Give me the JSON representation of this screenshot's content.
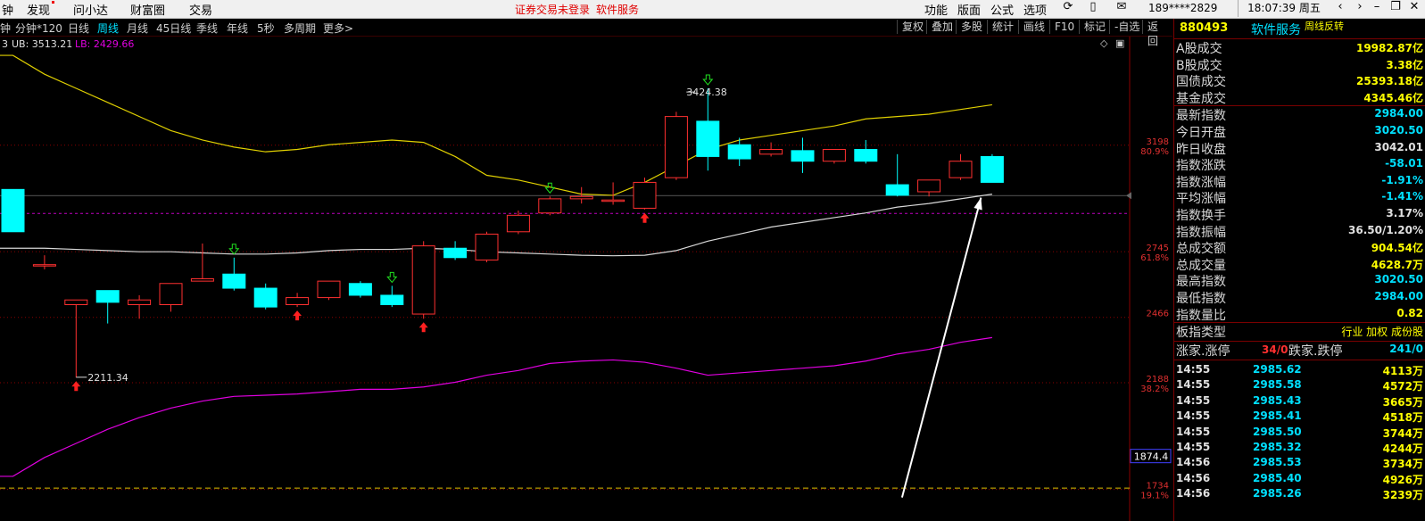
{
  "menu": {
    "items": [
      "钟",
      "发现",
      "问小达",
      "财富圈",
      "交易"
    ],
    "notice1": "证券交易未登录",
    "notice2": "软件服务",
    "right_items": [
      "功能",
      "版面",
      "公式",
      "选项"
    ],
    "phone": "189****2829",
    "clock": "18:07:39 周五"
  },
  "tabs": {
    "items": [
      "分钟*120",
      "日线",
      "周线",
      "月线",
      "45日线",
      "季线",
      "年线",
      "5秒",
      "多周期",
      "更多>"
    ],
    "active": "周线",
    "right_buttons": [
      "复权",
      "叠加",
      "多股",
      "统计",
      "画线",
      "F10",
      "标记",
      "-自选",
      "返回"
    ]
  },
  "indicator": {
    "prefix": "3",
    "ub": "UB: 3513.21",
    "lb": "LB: 2429.66"
  },
  "colors": {
    "up": "#ff3030",
    "down": "#00ffff",
    "upper_band": "#e0d000",
    "mid_band": "#d8d8d8",
    "lower_band": "#e000e0",
    "grid": "#8a0000",
    "level_line": "#e0c000",
    "current_price_line": "#c000c0"
  },
  "chart_data": {
    "type": "candlestick",
    "y_range": [
      1600,
      3660
    ],
    "axis_labels": [
      {
        "price": 3198,
        "label": "3198",
        "pct": "80.9%"
      },
      {
        "price": 2745,
        "label": "2745",
        "pct": "61.8%"
      },
      {
        "price": 2466,
        "label": "2466",
        "pct": ""
      },
      {
        "price": 2188,
        "label": "2188",
        "pct": "38.2%"
      },
      {
        "price": 1734,
        "label": "1734",
        "pct": "19.1%"
      }
    ],
    "cursor_label": "1874.4",
    "level_line_price": 1740,
    "current_price": 2984,
    "high_mark": {
      "price": 3424.38,
      "label": "3424.38"
    },
    "low_mark": {
      "price": 2211.34,
      "label": "2211.34"
    },
    "candles": [
      {
        "o": 3010,
        "h": 3010,
        "c": 2830,
        "l": 2830
      },
      {
        "o": 2690,
        "h": 2730,
        "c": 2690,
        "l": 2670
      },
      {
        "o": 2520,
        "h": 2530,
        "c": 2540,
        "l": 2210
      },
      {
        "o": 2580,
        "h": 2580,
        "c": 2530,
        "l": 2440
      },
      {
        "o": 2520,
        "h": 2560,
        "c": 2540,
        "l": 2460
      },
      {
        "o": 2520,
        "h": 2600,
        "c": 2610,
        "l": 2490
      },
      {
        "o": 2620,
        "h": 2780,
        "c": 2630,
        "l": 2620
      },
      {
        "o": 2650,
        "h": 2720,
        "c": 2590,
        "l": 2580
      },
      {
        "o": 2590,
        "h": 2610,
        "c": 2510,
        "l": 2500
      },
      {
        "o": 2520,
        "h": 2570,
        "c": 2550,
        "l": 2510
      },
      {
        "o": 2550,
        "h": 2600,
        "c": 2620,
        "l": 2540
      },
      {
        "o": 2610,
        "h": 2620,
        "c": 2560,
        "l": 2550
      },
      {
        "o": 2560,
        "h": 2600,
        "c": 2520,
        "l": 2510
      },
      {
        "o": 2480,
        "h": 2790,
        "c": 2770,
        "l": 2460
      },
      {
        "o": 2760,
        "h": 2790,
        "c": 2720,
        "l": 2710
      },
      {
        "o": 2710,
        "h": 2830,
        "c": 2820,
        "l": 2700
      },
      {
        "o": 2830,
        "h": 2920,
        "c": 2900,
        "l": 2820
      },
      {
        "o": 2910,
        "h": 2980,
        "c": 2970,
        "l": 2900
      },
      {
        "o": 2970,
        "h": 3020,
        "c": 2980,
        "l": 2950
      },
      {
        "o": 2960,
        "h": 3040,
        "c": 2965,
        "l": 2945
      },
      {
        "o": 2930,
        "h": 3060,
        "c": 3040,
        "l": 2925
      },
      {
        "o": 3060,
        "h": 3340,
        "c": 3320,
        "l": 3050
      },
      {
        "o": 3300,
        "h": 3440,
        "c": 3150,
        "l": 3090
      },
      {
        "o": 3200,
        "h": 3230,
        "c": 3140,
        "l": 3110
      },
      {
        "o": 3160,
        "h": 3210,
        "c": 3180,
        "l": 3150
      },
      {
        "o": 3175,
        "h": 3230,
        "c": 3130,
        "l": 3080
      },
      {
        "o": 3130,
        "h": 3180,
        "c": 3180,
        "l": 3120
      },
      {
        "o": 3180,
        "h": 3220,
        "c": 3130,
        "l": 3120
      },
      {
        "o": 3030,
        "h": 3160,
        "c": 2985,
        "l": 2980
      },
      {
        "o": 3000,
        "h": 3040,
        "c": 3050,
        "l": 2980
      },
      {
        "o": 3060,
        "h": 3160,
        "c": 3130,
        "l": 3050
      },
      {
        "o": 3150,
        "h": 3160,
        "c": 3040,
        "l": 3040
      }
    ],
    "upper_band": [
      3580,
      3500,
      3440,
      3380,
      3320,
      3260,
      3220,
      3190,
      3170,
      3180,
      3200,
      3210,
      3220,
      3210,
      3150,
      3070,
      3050,
      3020,
      2990,
      2985,
      3040,
      3110,
      3180,
      3220,
      3240,
      3260,
      3280,
      3310,
      3320,
      3330,
      3350,
      3370
    ],
    "mid_band": [
      2760,
      2760,
      2755,
      2750,
      2745,
      2745,
      2740,
      2735,
      2735,
      2740,
      2750,
      2755,
      2755,
      2760,
      2755,
      2745,
      2740,
      2735,
      2730,
      2728,
      2730,
      2750,
      2790,
      2820,
      2850,
      2870,
      2890,
      2910,
      2935,
      2950,
      2970,
      2990
    ],
    "lower_band": [
      1790,
      1870,
      1930,
      1990,
      2040,
      2080,
      2110,
      2130,
      2135,
      2140,
      2150,
      2160,
      2160,
      2170,
      2190,
      2220,
      2240,
      2270,
      2280,
      2285,
      2275,
      2250,
      2220,
      2230,
      2240,
      2250,
      2260,
      2280,
      2310,
      2330,
      2360,
      2380
    ],
    "buy_arrows": [
      2,
      9,
      13,
      20
    ],
    "sell_arrows": [
      7,
      12,
      17,
      22
    ],
    "arrow": {
      "from_price": 1700,
      "to_price": 2975,
      "from_idx": 28.5,
      "to_idx": 31.0
    }
  },
  "panel": {
    "code": "880493",
    "name": "软件服务",
    "tag": "周线反转",
    "rows1": [
      {
        "k": "A股成交",
        "v": "19982.87亿",
        "c": "yellow"
      },
      {
        "k": "B股成交",
        "v": "3.38亿",
        "c": "yellow"
      },
      {
        "k": "国债成交",
        "v": "25393.18亿",
        "c": "yellow"
      },
      {
        "k": "基金成交",
        "v": "4345.46亿",
        "c": "yellow"
      }
    ],
    "rows2": [
      {
        "k": "最新指数",
        "v": "2984.00",
        "c": "cyan"
      },
      {
        "k": "今日开盘",
        "v": "3020.50",
        "c": "cyan"
      },
      {
        "k": "昨日收盘",
        "v": "3042.01",
        "c": "white"
      },
      {
        "k": "指数涨跌",
        "v": "-58.01",
        "c": "cyan"
      },
      {
        "k": "指数涨幅",
        "v": "-1.91%",
        "c": "cyan"
      },
      {
        "k": "平均涨幅",
        "v": "-1.41%",
        "c": "cyan"
      },
      {
        "k": "指数换手",
        "v": "3.17%",
        "c": "white"
      },
      {
        "k": "指数振幅",
        "v": "36.50/1.20%",
        "c": "white"
      },
      {
        "k": "总成交额",
        "v": "904.54亿",
        "c": "yellow"
      },
      {
        "k": "总成交量",
        "v": "4628.7万",
        "c": "yellow"
      },
      {
        "k": "最高指数",
        "v": "3020.50",
        "c": "cyan"
      },
      {
        "k": "最低指数",
        "v": "2984.00",
        "c": "cyan"
      },
      {
        "k": "指数量比",
        "v": "0.82",
        "c": "yellow"
      }
    ],
    "type_label": "板指类型",
    "type_value": "行业 加权 成份股",
    "updown": {
      "k1": "涨家.涨停",
      "v1": "34/0",
      "k2": "跌家.跌停",
      "v2": "241/0"
    },
    "ticks": [
      {
        "t": "14:55",
        "p": "2985.62",
        "v": "4113万"
      },
      {
        "t": "14:55",
        "p": "2985.58",
        "v": "4572万"
      },
      {
        "t": "14:55",
        "p": "2985.43",
        "v": "3665万"
      },
      {
        "t": "14:55",
        "p": "2985.41",
        "v": "4518万"
      },
      {
        "t": "14:55",
        "p": "2985.50",
        "v": "3744万"
      },
      {
        "t": "14:55",
        "p": "2985.32",
        "v": "4244万"
      },
      {
        "t": "14:56",
        "p": "2985.53",
        "v": "3734万"
      },
      {
        "t": "14:56",
        "p": "2985.40",
        "v": "4926万"
      },
      {
        "t": "14:56",
        "p": "2985.26",
        "v": "3239万"
      }
    ]
  }
}
